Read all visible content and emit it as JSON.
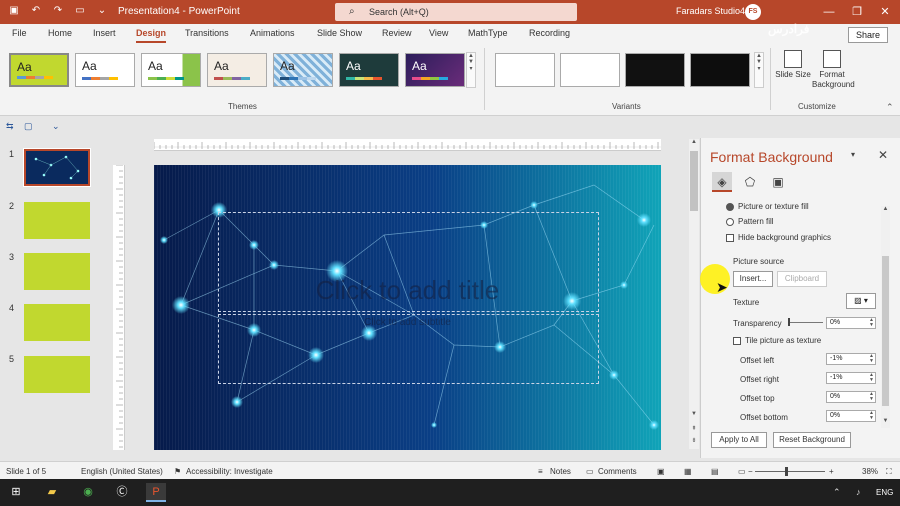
{
  "window": {
    "title": "Presentation4 - PowerPoint",
    "search_placeholder": "Search (Alt+Q)",
    "user": "Faradars Studio4",
    "user_initials": "FS",
    "minimize": "—",
    "restore": "❐",
    "close": "✕"
  },
  "menu": {
    "file": "File",
    "home": "Home",
    "insert": "Insert",
    "design": "Design",
    "transitions": "Transitions",
    "animations": "Animations",
    "slide_show": "Slide Show",
    "review": "Review",
    "view": "View",
    "mathtype": "MathType",
    "recording": "Recording",
    "share": "Share"
  },
  "ribbon": {
    "themes_label": "Themes",
    "variants_label": "Variants",
    "customize_label": "Customize",
    "theme_text": "Aa",
    "slide_size": "Slide Size",
    "format_background": "Format Background"
  },
  "slides": {
    "numbers": [
      "1",
      "2",
      "3",
      "4",
      "5"
    ]
  },
  "slide_canvas": {
    "title_placeholder": "Click to add title",
    "subtitle_placeholder": "Click to add subtitle"
  },
  "format_pane": {
    "title": "Format Background",
    "picture_texture_fill": "Picture or texture fill",
    "pattern_fill": "Pattern fill",
    "hide_graphics": "Hide background graphics",
    "picture_source": "Picture source",
    "insert_btn": "Insert...",
    "clipboard_btn": "Clipboard",
    "texture": "Texture",
    "transparency": "Transparency",
    "transparency_value": "0%",
    "tile_picture": "Tile picture as texture",
    "offset_left": "Offset left",
    "offset_left_value": "-1%",
    "offset_right": "Offset right",
    "offset_right_value": "-1%",
    "offset_top": "Offset top",
    "offset_top_value": "0%",
    "offset_bottom": "Offset bottom",
    "offset_bottom_value": "0%",
    "apply_all": "Apply to All",
    "reset_bg": "Reset Background"
  },
  "status": {
    "slide_info": "Slide 1 of 5",
    "language": "English (United States)",
    "accessibility": "Accessibility: Investigate",
    "notes": "Notes",
    "comments": "Comments",
    "zoom": "38%"
  },
  "taskbar": {
    "lang": "ENG"
  },
  "watermark": "فرادرس",
  "colors": {
    "accent": "#b7472a",
    "lime": "#c1d82f"
  }
}
